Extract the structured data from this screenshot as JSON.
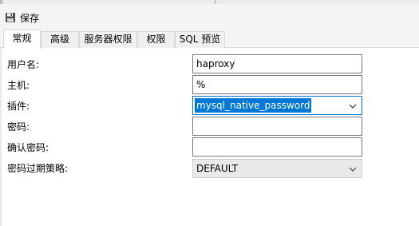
{
  "toolbar": {
    "save_label": "保存",
    "save_icon": "save-icon"
  },
  "tabs": [
    {
      "label": "常规",
      "active": true
    },
    {
      "label": "高级",
      "active": false
    },
    {
      "label": "服务器权限",
      "active": false
    },
    {
      "label": "权限",
      "active": false
    },
    {
      "label": "SQL 预览",
      "active": false
    }
  ],
  "form": {
    "username": {
      "label": "用户名:",
      "value": "haproxy"
    },
    "host": {
      "label": "主机:",
      "value": "%"
    },
    "plugin": {
      "label": "插件:",
      "value": "mysql_native_password"
    },
    "password": {
      "label": "密码:",
      "value": ""
    },
    "confirm_password": {
      "label": "确认密码:",
      "value": ""
    },
    "password_expiry": {
      "label": "密码过期策略:",
      "value": "DEFAULT"
    }
  },
  "colors": {
    "accent": "#0078d7",
    "toolbar_bg": "#f4f4f4",
    "input_border": "#7a7a7a"
  }
}
